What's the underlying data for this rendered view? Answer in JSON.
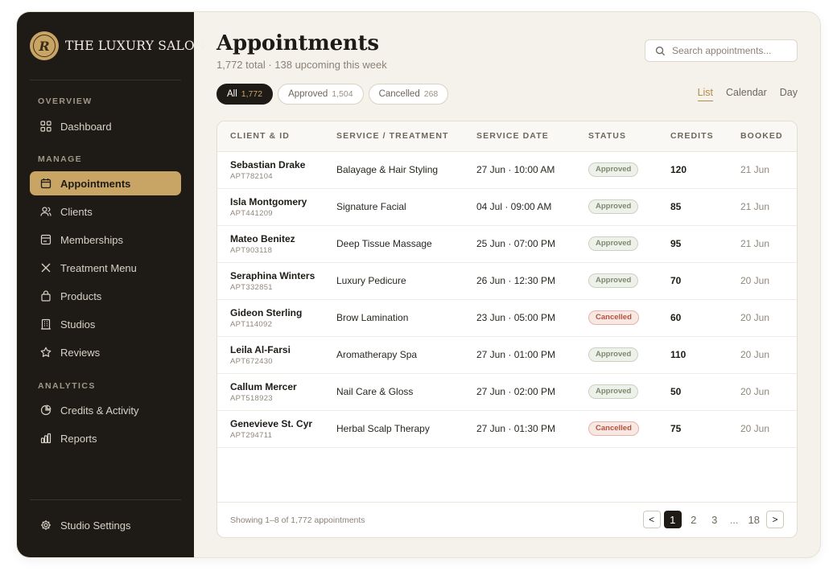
{
  "brand": {
    "name": "THE LUXURY SALON",
    "logo_text": "R"
  },
  "sidebar": {
    "sections": [
      {
        "label": "OVERVIEW"
      },
      {
        "label": "MANAGE"
      },
      {
        "label": "ANALYTICS"
      }
    ],
    "items": [
      {
        "label": "Dashboard",
        "icon": "grid-icon"
      },
      {
        "label": "Appointments",
        "icon": "calendar-icon",
        "active": true
      },
      {
        "label": "Clients",
        "icon": "users-icon"
      },
      {
        "label": "Memberships",
        "icon": "card-icon"
      },
      {
        "label": "Treatment Menu",
        "icon": "scissors-icon"
      },
      {
        "label": "Products",
        "icon": "bag-icon"
      },
      {
        "label": "Studios",
        "icon": "building-icon"
      },
      {
        "label": "Reviews",
        "icon": "star-icon"
      },
      {
        "label": "Credits & Activity",
        "icon": "pie-chart-icon"
      },
      {
        "label": "Reports",
        "icon": "bar-chart-icon"
      }
    ],
    "settings_label": "Studio Settings"
  },
  "header": {
    "title": "Appointments",
    "subtitle": "1,772 total · 138 upcoming this week",
    "search_placeholder": "Search appointments..."
  },
  "filters": [
    {
      "label": "All",
      "count": "1,772",
      "active": true
    },
    {
      "label": "Approved",
      "count": "1,504"
    },
    {
      "label": "Cancelled",
      "count": "268"
    }
  ],
  "views": [
    {
      "label": "List",
      "active": true
    },
    {
      "label": "Calendar"
    },
    {
      "label": "Day"
    }
  ],
  "table": {
    "columns": [
      "CLIENT & ID",
      "SERVICE / TREATMENT",
      "SERVICE DATE",
      "STATUS",
      "CREDITS",
      "BOOKED"
    ],
    "rows": [
      {
        "name": "Sebastian Drake",
        "id": "APT782104",
        "service": "Balayage & Hair Styling",
        "date": "27 Jun · 10:00 AM",
        "status": "Approved",
        "credits": "120",
        "booked": "21 Jun"
      },
      {
        "name": "Isla Montgomery",
        "id": "APT441209",
        "service": "Signature Facial",
        "date": "04 Jul · 09:00 AM",
        "status": "Approved",
        "credits": "85",
        "booked": "21 Jun"
      },
      {
        "name": "Mateo Benitez",
        "id": "APT903118",
        "service": "Deep Tissue Massage",
        "date": "25 Jun · 07:00 PM",
        "status": "Approved",
        "credits": "95",
        "booked": "21 Jun"
      },
      {
        "name": "Seraphina Winters",
        "id": "APT332851",
        "service": "Luxury Pedicure",
        "date": "26 Jun · 12:30 PM",
        "status": "Approved",
        "credits": "70",
        "booked": "20 Jun"
      },
      {
        "name": "Gideon Sterling",
        "id": "APT114092",
        "service": "Brow Lamination",
        "date": "23 Jun · 05:00 PM",
        "status": "Cancelled",
        "credits": "60",
        "booked": "20 Jun"
      },
      {
        "name": "Leila Al-Farsi",
        "id": "APT672430",
        "service": "Aromatherapy Spa",
        "date": "27 Jun · 01:00 PM",
        "status": "Approved",
        "credits": "110",
        "booked": "20 Jun"
      },
      {
        "name": "Callum Mercer",
        "id": "APT518923",
        "service": "Nail Care & Gloss",
        "date": "27 Jun · 02:00 PM",
        "status": "Approved",
        "credits": "50",
        "booked": "20 Jun"
      },
      {
        "name": "Genevieve St. Cyr",
        "id": "APT294711",
        "service": "Herbal Scalp Therapy",
        "date": "27 Jun · 01:30 PM",
        "status": "Cancelled",
        "credits": "75",
        "booked": "20 Jun"
      }
    ]
  },
  "footer": {
    "showing": "Showing 1–8 of 1,772 appointments",
    "prev": "<",
    "next": ">",
    "pages": [
      "1",
      "2",
      "3",
      "...",
      "18"
    ],
    "current_page": "1"
  },
  "colors": {
    "accent": "#c9a565",
    "sidebar_bg": "#1e1b17",
    "page_bg": "#f5f2ec",
    "approved": "#7d8a6e",
    "cancelled": "#b5513f"
  }
}
